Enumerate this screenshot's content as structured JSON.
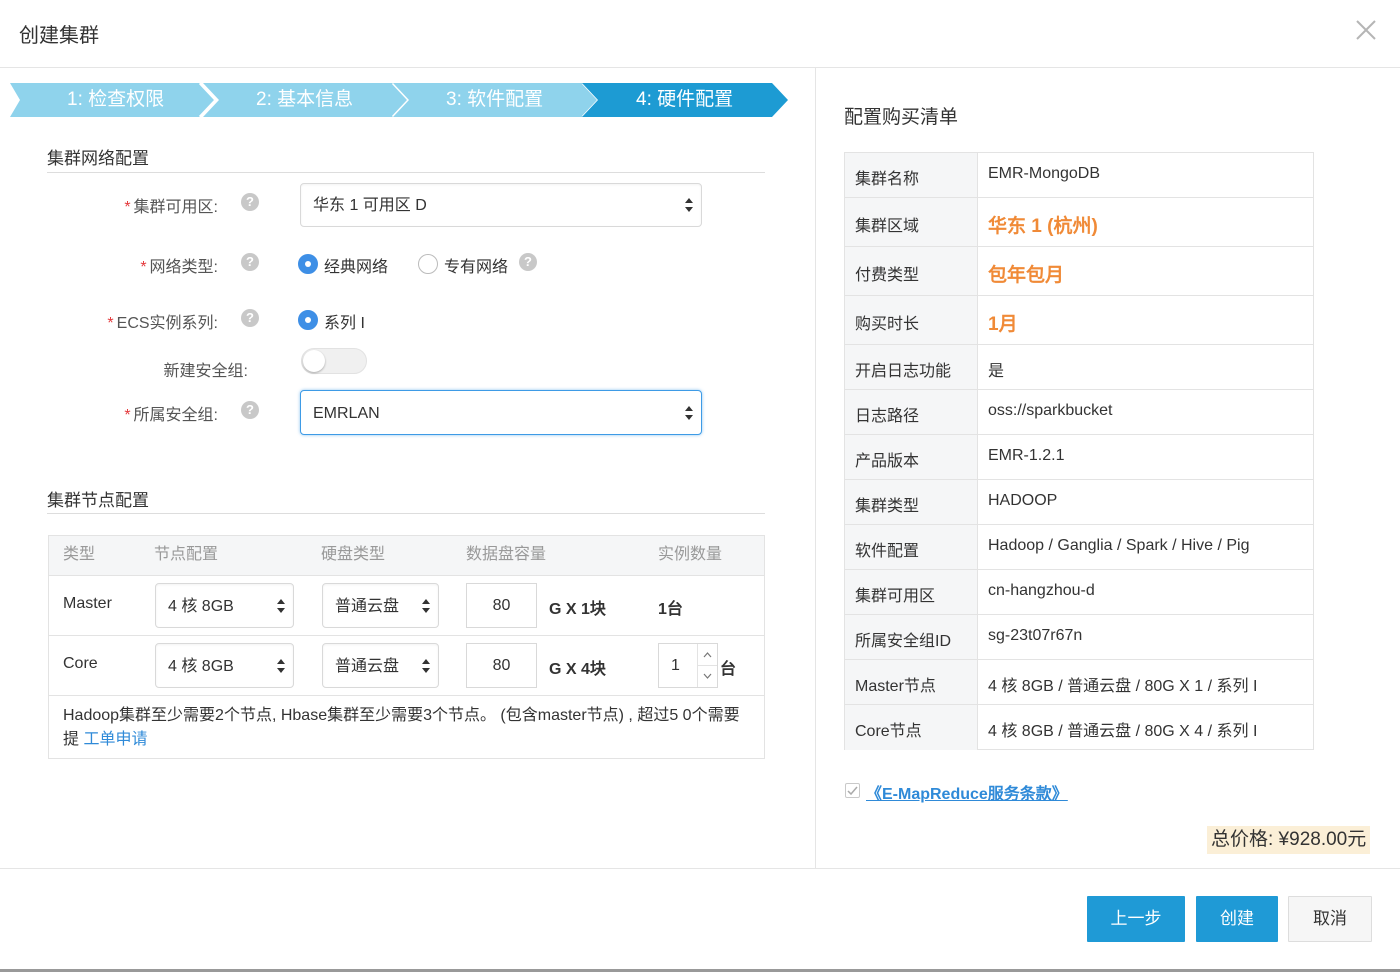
{
  "dialog": {
    "title": "创建集群"
  },
  "steps": [
    {
      "label": "1:  检查权限",
      "active": false
    },
    {
      "label": "2:  基本信息",
      "active": false
    },
    {
      "label": "3:  软件配置",
      "active": false
    },
    {
      "label": "4:  硬件配置",
      "active": true
    }
  ],
  "network": {
    "section_title": "集群网络配置",
    "zone_label": "集群可用区:",
    "zone_value": "华东 1 可用区 D",
    "net_type_label": "网络类型:",
    "net_type_options": [
      "经典网络",
      "专有网络"
    ],
    "net_type_selected": "经典网络",
    "ecs_label": "ECS实例系列:",
    "ecs_option": "系列 I",
    "new_sg_label": "新建安全组:",
    "new_sg_on": false,
    "sg_label": "所属安全组:",
    "sg_value": "EMRLAN",
    "required_mark": "*",
    "help_glyph": "?"
  },
  "nodes": {
    "section_title": "集群节点配置",
    "columns": [
      "类型",
      "节点配置",
      "硬盘类型",
      "数据盘容量",
      "实例数量"
    ],
    "rows": [
      {
        "type": "Master",
        "spec": "4 核 8GB",
        "disk": "普通云盘",
        "capacity": "80",
        "unit": "G X 1块",
        "count": "1台"
      },
      {
        "type": "Core",
        "spec": "4 核 8GB",
        "disk": "普通云盘",
        "capacity": "80",
        "unit": "G X 4块",
        "count": "1",
        "count_unit": "台"
      }
    ],
    "note_text": "Hadoop集群至少需要2个节点, Hbase集群至少需要3个节点。 (包含master节点) , 超过5 0个需要提 ",
    "note_link": "工单申请"
  },
  "summary": {
    "title": "配置购买清单",
    "rows": [
      {
        "key": "集群名称",
        "value": "EMR-MongoDB",
        "highlight": false
      },
      {
        "key": "集群区域",
        "value": "华东 1 (杭州)",
        "highlight": true
      },
      {
        "key": "付费类型",
        "value": "包年包月",
        "highlight": true
      },
      {
        "key": "购买时长",
        "value": "1月",
        "highlight": true
      },
      {
        "key": "开启日志功能",
        "value": "是",
        "highlight": false
      },
      {
        "key": "日志路径",
        "value": "oss://sparkbucket",
        "highlight": false
      },
      {
        "key": "产品版本",
        "value": "EMR-1.2.1",
        "highlight": false
      },
      {
        "key": "集群类型",
        "value": "HADOOP",
        "highlight": false
      },
      {
        "key": "软件配置",
        "value": "Hadoop / Ganglia / Spark / Hive / Pig",
        "highlight": false
      },
      {
        "key": "集群可用区",
        "value": "cn-hangzhou-d",
        "highlight": false
      },
      {
        "key": "所属安全组ID",
        "value": "sg-23t07r67n",
        "highlight": false
      },
      {
        "key": "Master节点",
        "value": "4 核 8GB / 普通云盘 / 80G X 1 / 系列 I",
        "highlight": false
      },
      {
        "key": "Core节点",
        "value": "4 核 8GB / 普通云盘 / 80G X 4 / 系列 I",
        "highlight": false
      }
    ],
    "terms_label": "《E-MapReduce服务条款》",
    "terms_checked": true,
    "price_label": "总价格: ¥928.00元"
  },
  "footer": {
    "prev_label": "上一步",
    "create_label": "创建",
    "cancel_label": "取消"
  },
  "colors": {
    "step_inactive": "#8fd3ec",
    "step_active": "#1d9bd3",
    "primary": "#1f9ad6",
    "highlight": "#f08a37",
    "link": "#2f8ad8"
  }
}
